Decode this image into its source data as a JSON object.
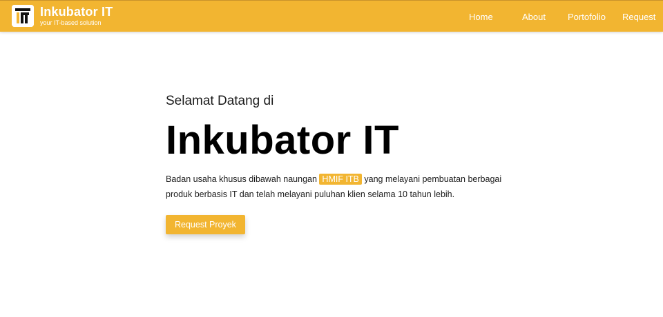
{
  "navbar": {
    "brand_title": "Inkubator IT",
    "brand_tagline": "your IT-based solution",
    "logo_icon": "it-logo-icon",
    "background_color": "#F2B531",
    "links": [
      {
        "label": "Home"
      },
      {
        "label": "About"
      },
      {
        "label": "Portofolio"
      },
      {
        "label": "Request"
      }
    ]
  },
  "hero": {
    "greeting": "Selamat Datang di",
    "title": "Inkubator IT",
    "description_before": "Badan usaha khusus dibawah naungan",
    "description_highlight": "HMIF ITB",
    "description_after": "yang melayani pembuatan berbagai produk berbasis IT dan telah melayani puluhan klien selama 10 tahun lebih.",
    "cta_label": "Request Proyek",
    "accent_color": "#F2B531"
  }
}
